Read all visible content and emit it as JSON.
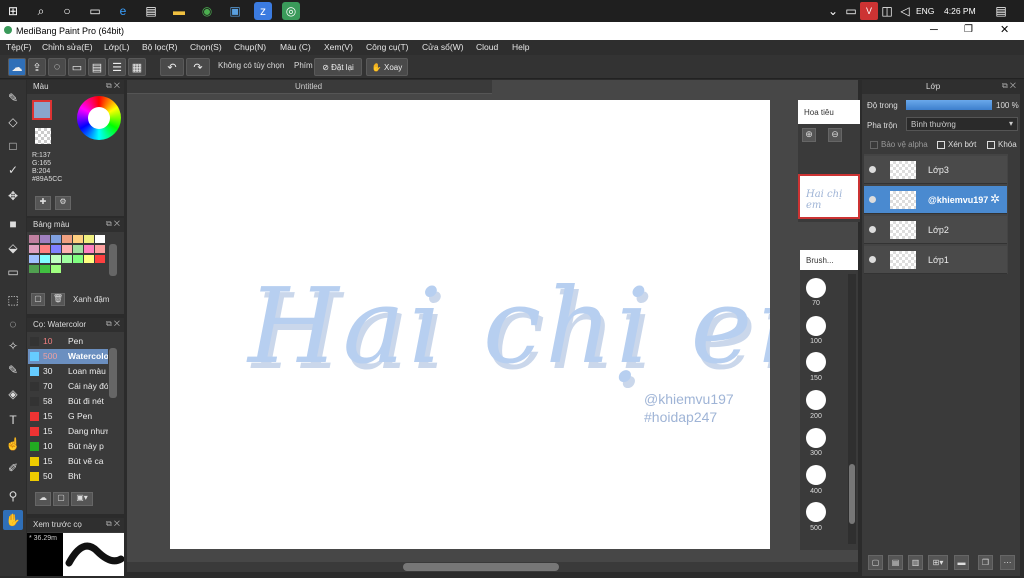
{
  "taskbar": {
    "lang": "ENG",
    "time": "4:26 PM"
  },
  "window": {
    "title": "MediBang Paint Pro (64bit)"
  },
  "menu": [
    "Tệp(F)",
    "Chỉnh sửa(E)",
    "Lớp(L)",
    "Bộ lọc(R)",
    "Chọn(S)",
    "Chụp(N)",
    "Màu (C)",
    "Xem(V)",
    "Công cụ(T)",
    "Cửa sổ(W)",
    "Cloud",
    "Help"
  ],
  "toolbar": {
    "option_label": "Không có tùy chọn",
    "key_label": "Phím",
    "reset_label": "Đặt lại",
    "rotate_label": "Xoay"
  },
  "color_panel": {
    "title": "Màu",
    "r": "R:137",
    "g": "G:165",
    "b": "B:204",
    "hex": "#89A5CC",
    "primary": "#89A5CC"
  },
  "palette_panel": {
    "title": "Bảng màu",
    "color_name": "Xanh đậm"
  },
  "brush_panel": {
    "title": "Cọ: Watercolor",
    "items": [
      {
        "size": "10",
        "name": "Pen",
        "color": "#333333"
      },
      {
        "size": "500",
        "name": "Watercolor",
        "color": "#66ccff",
        "selected": true
      },
      {
        "size": "30",
        "name": "Loan màu",
        "color": "#66ccff"
      },
      {
        "size": "70",
        "name": "Cái này đó",
        "color": "#333333"
      },
      {
        "size": "58",
        "name": "Bút đi nét",
        "color": "#333333"
      },
      {
        "size": "15",
        "name": "G Pen",
        "color": "#ee3333"
      },
      {
        "size": "15",
        "name": "Dang nhưng",
        "color": "#ee3333"
      },
      {
        "size": "10",
        "name": "Bút này p",
        "color": "#22aa22"
      },
      {
        "size": "15",
        "name": "Bút vẽ ca",
        "color": "#eecc00"
      },
      {
        "size": "50",
        "name": "Bht",
        "color": "#eecc00"
      }
    ]
  },
  "preview_panel": {
    "title": "Xem trước cọ",
    "zoom": "* 36.29m"
  },
  "canvas": {
    "tab_title": "Untitled",
    "art_text": "Hai chị em",
    "credit1": "@khiemvu197",
    "credit2": "#hoidap247"
  },
  "navigator": {
    "title": "Hoa tiêu",
    "thumb_text": "Hai chị em"
  },
  "brush_size_panel": {
    "title": "Brush...",
    "sizes": [
      "70",
      "100",
      "150",
      "200",
      "300",
      "400",
      "500"
    ]
  },
  "layer_panel": {
    "title": "Lớp",
    "opacity_label": "Độ trong",
    "opacity_value": "100 %",
    "opacity_fraction": 1.0,
    "blend_label": "Pha trộn",
    "blend_value": "Bình thường",
    "protect_alpha": "Bảo vệ alpha",
    "clip": "Xén bớt",
    "lock": "Khóa",
    "layers": [
      {
        "name": "Lớp3",
        "selected": false
      },
      {
        "name": "@khiemvu197",
        "selected": true
      },
      {
        "name": "Lớp2",
        "selected": false
      },
      {
        "name": "Lớp1",
        "selected": false
      }
    ]
  }
}
